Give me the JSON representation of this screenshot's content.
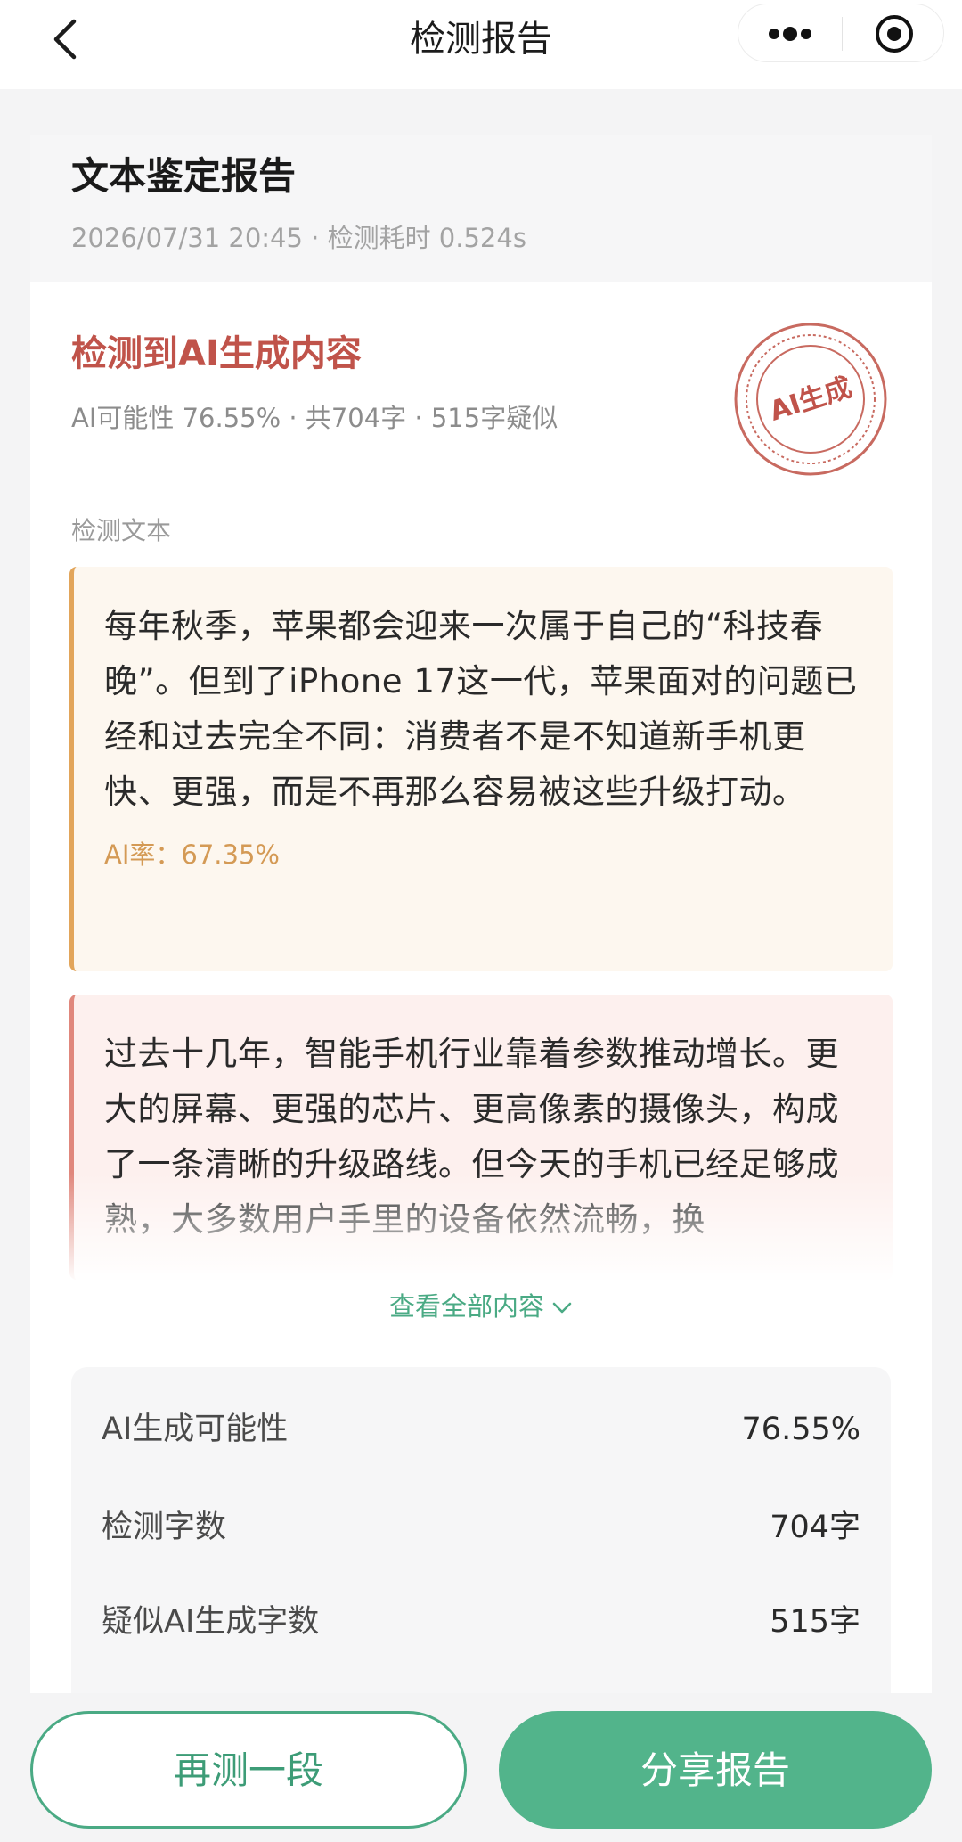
{
  "navbar": {
    "title": "检测报告",
    "back_icon": "chevron-left-icon",
    "more_icon": "more-dots-icon",
    "close_icon": "target-close-icon"
  },
  "header": {
    "title": "文本鉴定报告",
    "meta": "2026/07/31 20:45 · 检测耗时 0.524s"
  },
  "result": {
    "verdict": "检测到AI生成内容",
    "summary": "AI可能性 76.55% · 共704字 · 515字疑似",
    "stamp_text": "AI生成",
    "accent_color": "#c0534a"
  },
  "detected": {
    "label": "检测文本",
    "paragraphs": [
      {
        "text": "每年秋季，苹果都会迎来一次属于自己的“科技春晚”。但到了iPhone 17这一代，苹果面对的问题已经和过去完全不同：消费者不是不知道新手机更快、更强，而是不再那么容易被这些升级打动。",
        "rate": "AI率：67.35%",
        "color": "#e2a55a"
      },
      {
        "text": "过去十几年，智能手机行业靠着参数推动增长。更大的屏幕、更强的芯片、更高像素的摄像头，构成了一条清晰的升级路线。但今天的手机已经足够成熟，大多数用户手里的设备依然流畅，换",
        "color": "#e0877c"
      }
    ],
    "expand_label": "查看全部内容"
  },
  "stats": [
    {
      "label": "AI生成可能性",
      "value": "76.55%"
    },
    {
      "label": "检测字数",
      "value": "704字"
    },
    {
      "label": "疑似AI生成字数",
      "value": "515字"
    }
  ],
  "actions": {
    "retest_label": "再测一段",
    "share_label": "分享报告",
    "brand_color": "#52b48b"
  }
}
